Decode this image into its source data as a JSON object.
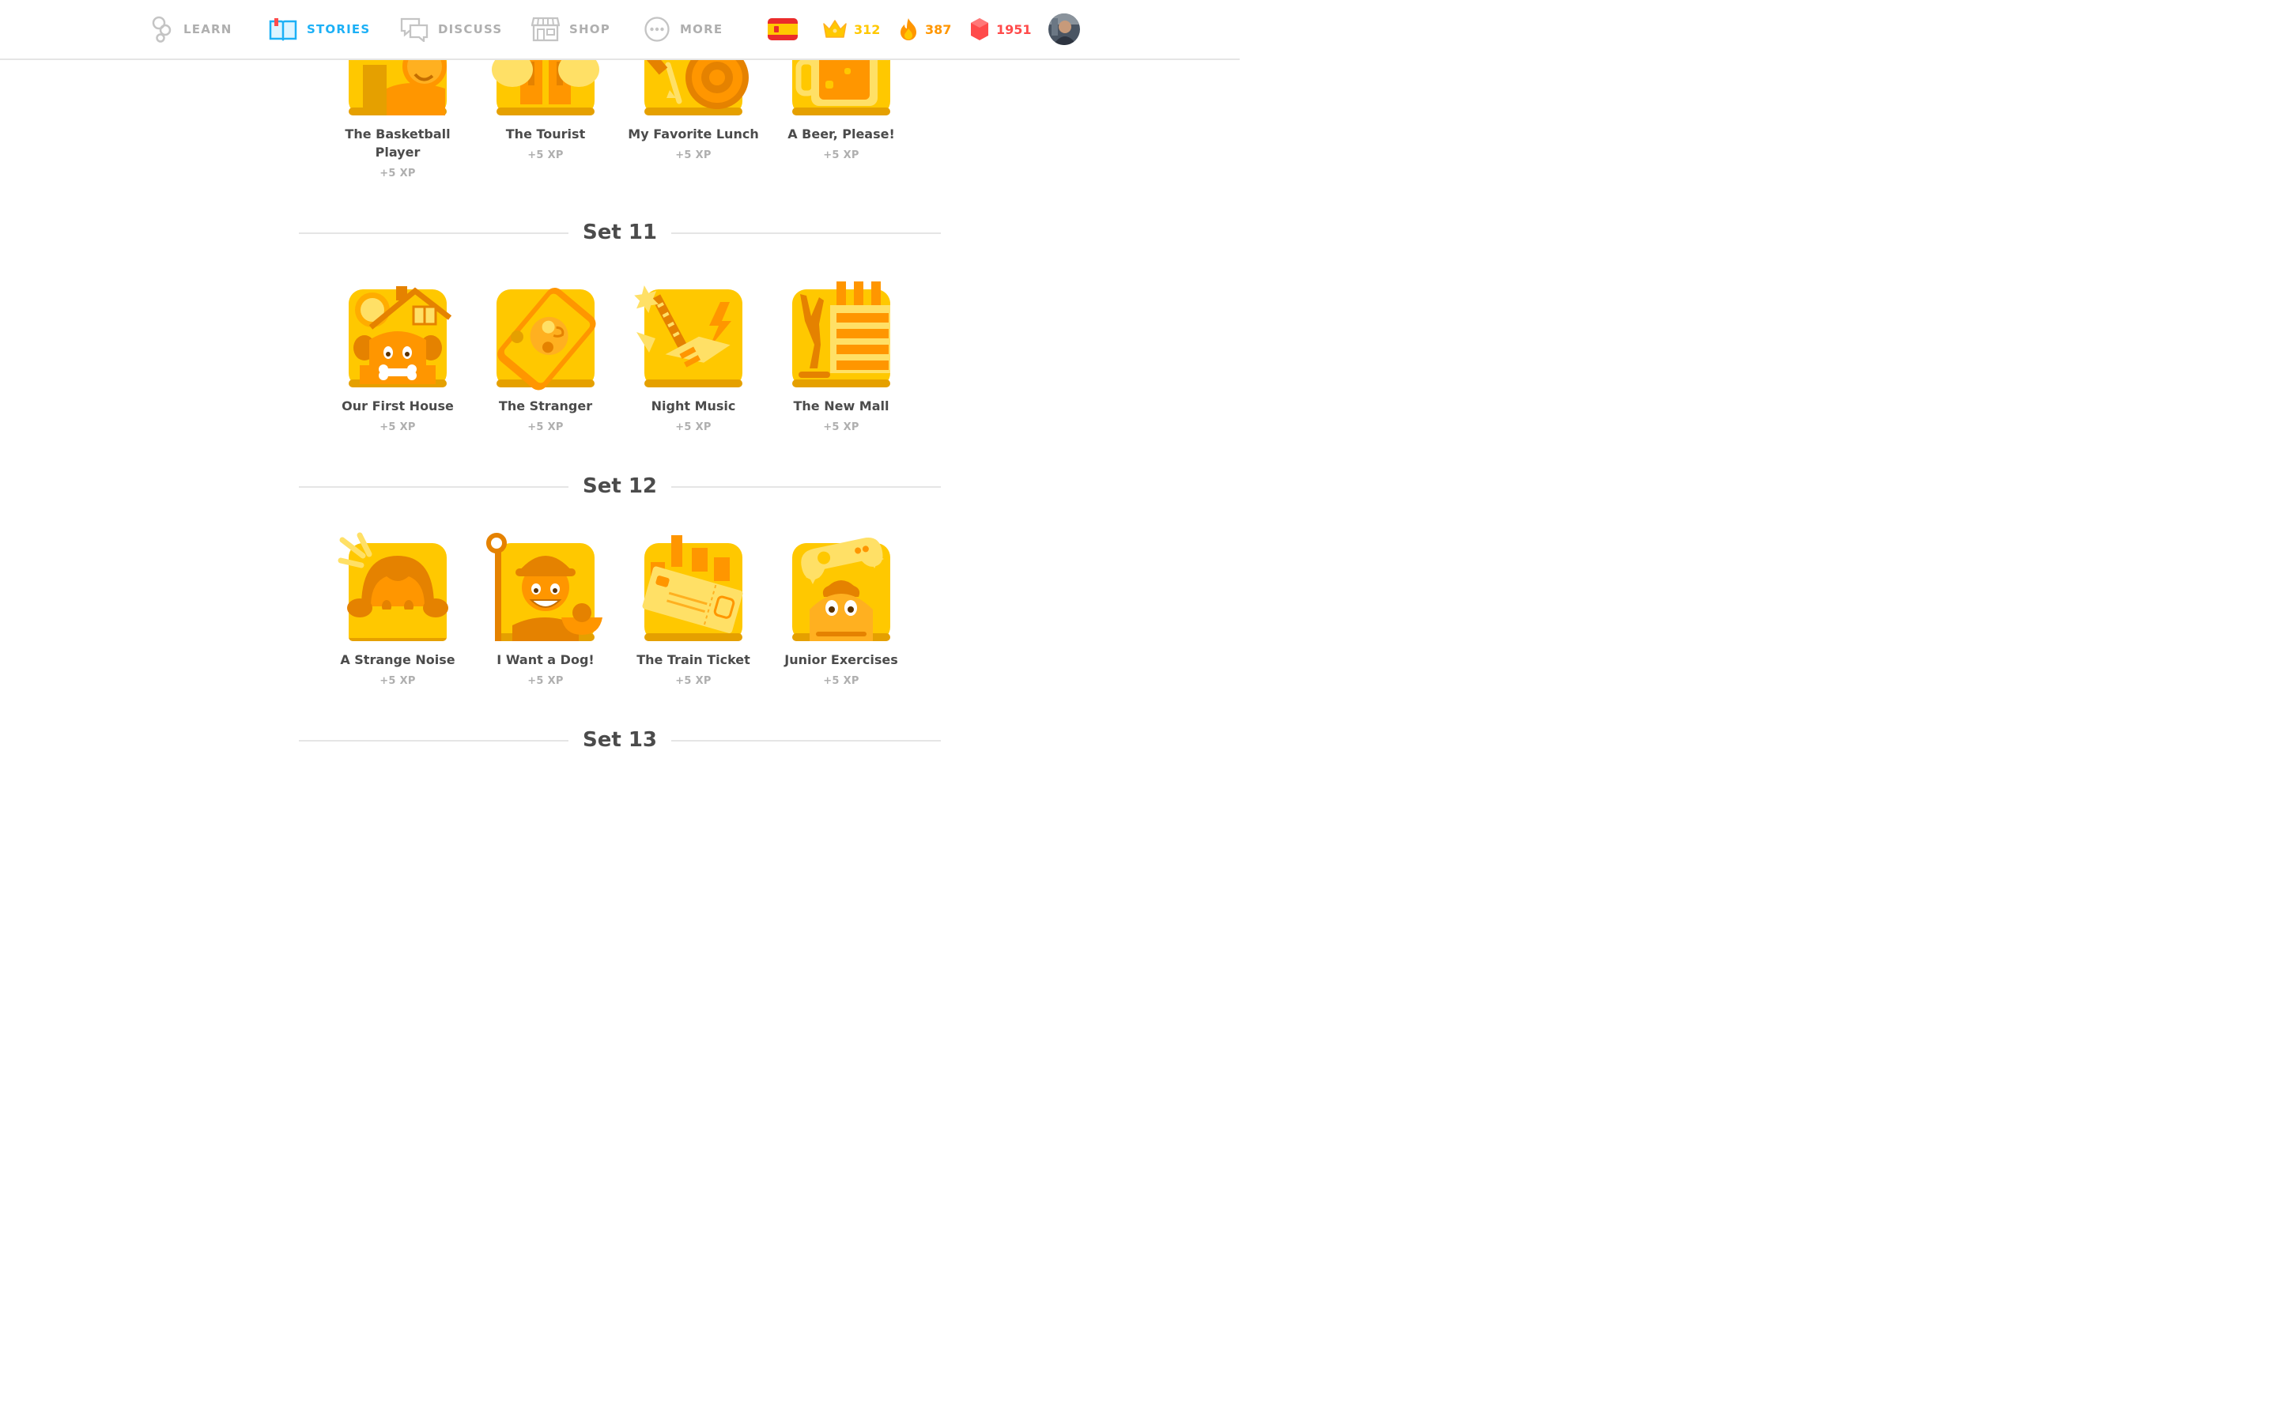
{
  "nav": {
    "items": [
      {
        "label": "LEARN",
        "icon": "learn-icon"
      },
      {
        "label": "STORIES",
        "icon": "stories-icon",
        "active": true
      },
      {
        "label": "DISCUSS",
        "icon": "discuss-icon"
      },
      {
        "label": "SHOP",
        "icon": "shop-icon"
      },
      {
        "label": "MORE",
        "icon": "more-icon"
      }
    ],
    "stats": {
      "language_flag": "spain-flag-icon",
      "crowns": "312",
      "streak": "387",
      "gems": "1951"
    },
    "colors": {
      "active": "#1cb0f6",
      "inactive": "#afafaf",
      "crowns": "#ffc800",
      "streak": "#ff9600",
      "gems": "#ff4b4b"
    }
  },
  "previous_row": [
    {
      "title": "The Basketball Player",
      "xp": "+5 XP",
      "icon": "basketball-player-icon"
    },
    {
      "title": "The Tourist",
      "xp": "+5 XP",
      "icon": "tourist-icon"
    },
    {
      "title": "My Favorite Lunch",
      "xp": "+5 XP",
      "icon": "lunch-icon"
    },
    {
      "title": "A Beer, Please!",
      "xp": "+5 XP",
      "icon": "beer-icon"
    }
  ],
  "sets": [
    {
      "title": "Set 11",
      "stories": [
        {
          "title": "Our First House",
          "xp": "+5 XP",
          "icon": "house-dog-icon"
        },
        {
          "title": "The Stranger",
          "xp": "+5 XP",
          "icon": "phone-map-icon"
        },
        {
          "title": "Night Music",
          "xp": "+5 XP",
          "icon": "guitar-icon"
        },
        {
          "title": "The New Mall",
          "xp": "+5 XP",
          "icon": "mall-icon"
        }
      ]
    },
    {
      "title": "Set 12",
      "stories": [
        {
          "title": "A Strange Noise",
          "xp": "+5 XP",
          "icon": "peeking-kid-icon"
        },
        {
          "title": "I Want a Dog!",
          "xp": "+5 XP",
          "icon": "shepherd-icon"
        },
        {
          "title": "The Train Ticket",
          "xp": "+5 XP",
          "icon": "train-ticket-icon"
        },
        {
          "title": "Junior Exercises",
          "xp": "+5 XP",
          "icon": "game-controller-icon"
        }
      ]
    },
    {
      "title": "Set 13",
      "stories": []
    }
  ],
  "theme": {
    "tile_gold": "#ffc800",
    "tile_dark": "#e5a000",
    "tile_accent": "#ff9600"
  }
}
